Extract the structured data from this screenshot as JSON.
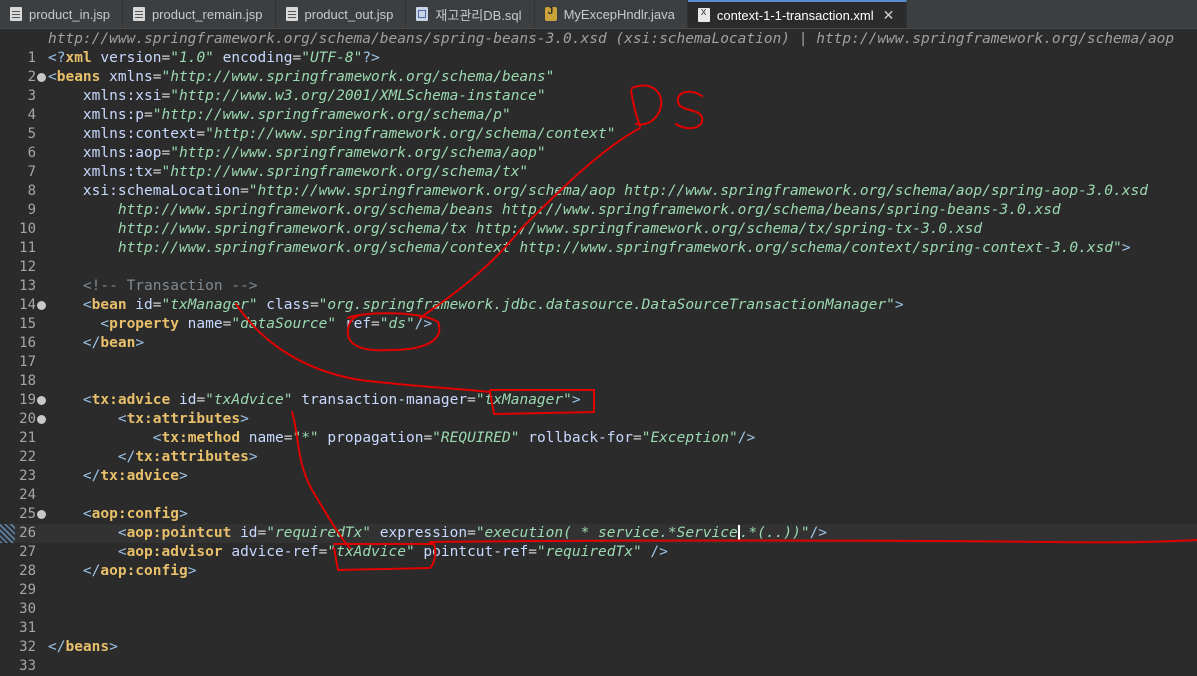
{
  "tabs": [
    {
      "label": "product_in.jsp",
      "icon": "jsp-file-icon"
    },
    {
      "label": "product_remain.jsp",
      "icon": "jsp-file-icon"
    },
    {
      "label": "product_out.jsp",
      "icon": "jsp-file-icon"
    },
    {
      "label": "재고관리DB.sql",
      "icon": "sql-file-icon"
    },
    {
      "label": "MyExcepHndlr.java",
      "icon": "java-file-icon"
    },
    {
      "label": "context-1-1-transaction.xml",
      "icon": "xml-file-icon",
      "active": true
    }
  ],
  "breadcrumb": "http://www.springframework.org/schema/beans/spring-beans-3.0.xsd (xsi:schemaLocation) | http://www.springframework.org/schema/aop",
  "lines": [
    {
      "n": "1",
      "tokens": [
        [
          "p",
          "<?"
        ],
        [
          "t",
          "xml"
        ],
        [
          "a",
          " version"
        ],
        [
          "pl",
          "="
        ],
        [
          "s",
          "\"1.0\""
        ],
        [
          "a",
          " encoding"
        ],
        [
          "pl",
          "="
        ],
        [
          "s",
          "\"UTF-8\""
        ],
        [
          "p",
          "?>"
        ]
      ]
    },
    {
      "n": "2",
      "fold": true,
      "tokens": [
        [
          "p",
          "<"
        ],
        [
          "t",
          "beans"
        ],
        [
          "a",
          " xmlns"
        ],
        [
          "pl",
          "="
        ],
        [
          "s",
          "\"http://www.springframework.org/schema/beans\""
        ]
      ]
    },
    {
      "n": "3",
      "tokens": [
        [
          "a",
          "    xmlns:xsi"
        ],
        [
          "pl",
          "="
        ],
        [
          "s",
          "\"http://www.w3.org/2001/XMLSchema-instance\""
        ]
      ]
    },
    {
      "n": "4",
      "tokens": [
        [
          "a",
          "    xmlns:p"
        ],
        [
          "pl",
          "="
        ],
        [
          "s",
          "\"http://www.springframework.org/schema/p\""
        ]
      ]
    },
    {
      "n": "5",
      "tokens": [
        [
          "a",
          "    xmlns:context"
        ],
        [
          "pl",
          "="
        ],
        [
          "s",
          "\"http://www.springframework.org/schema/context\""
        ]
      ]
    },
    {
      "n": "6",
      "tokens": [
        [
          "a",
          "    xmlns:aop"
        ],
        [
          "pl",
          "="
        ],
        [
          "s",
          "\"http://www.springframework.org/schema/aop\""
        ]
      ]
    },
    {
      "n": "7",
      "tokens": [
        [
          "a",
          "    xmlns:tx"
        ],
        [
          "pl",
          "="
        ],
        [
          "s",
          "\"http://www.springframework.org/schema/tx\""
        ]
      ]
    },
    {
      "n": "8",
      "tokens": [
        [
          "a",
          "    xsi:schemaLocation"
        ],
        [
          "pl",
          "="
        ],
        [
          "s",
          "\"http://www.springframework.org/schema/aop http://www.springframework.org/schema/aop/spring-aop-3.0.xsd"
        ]
      ]
    },
    {
      "n": "9",
      "tokens": [
        [
          "s",
          "        http://www.springframework.org/schema/beans http://www.springframework.org/schema/beans/spring-beans-3.0.xsd"
        ]
      ]
    },
    {
      "n": "10",
      "tokens": [
        [
          "s",
          "        http://www.springframework.org/schema/tx http://www.springframework.org/schema/tx/spring-tx-3.0.xsd"
        ]
      ]
    },
    {
      "n": "11",
      "tokens": [
        [
          "s",
          "        http://www.springframework.org/schema/context http://www.springframework.org/schema/context/spring-context-3.0.xsd\""
        ],
        [
          "p",
          ">"
        ]
      ]
    },
    {
      "n": "12",
      "tokens": []
    },
    {
      "n": "13",
      "tokens": [
        [
          "c",
          "    <!-- Transaction -->"
        ]
      ]
    },
    {
      "n": "14",
      "fold": true,
      "tokens": [
        [
          "p",
          "    <"
        ],
        [
          "t",
          "bean"
        ],
        [
          "a",
          " id"
        ],
        [
          "pl",
          "="
        ],
        [
          "s",
          "\"txManager\""
        ],
        [
          "a",
          " class"
        ],
        [
          "pl",
          "="
        ],
        [
          "s",
          "\"org.springframework.jdbc.datasource.DataSourceTransactionManager\""
        ],
        [
          "p",
          ">"
        ]
      ]
    },
    {
      "n": "15",
      "tokens": [
        [
          "p",
          "      <"
        ],
        [
          "t",
          "property"
        ],
        [
          "a",
          " name"
        ],
        [
          "pl",
          "="
        ],
        [
          "s",
          "\"dataSource\""
        ],
        [
          "a",
          " ref"
        ],
        [
          "pl",
          "="
        ],
        [
          "s",
          "\"ds\""
        ],
        [
          "p",
          "/>"
        ]
      ]
    },
    {
      "n": "16",
      "tokens": [
        [
          "p",
          "    </"
        ],
        [
          "t",
          "bean"
        ],
        [
          "p",
          ">"
        ]
      ]
    },
    {
      "n": "17",
      "tokens": []
    },
    {
      "n": "18",
      "tokens": []
    },
    {
      "n": "19",
      "fold": true,
      "tokens": [
        [
          "p",
          "    <"
        ],
        [
          "t",
          "tx:advice"
        ],
        [
          "a",
          " id"
        ],
        [
          "pl",
          "="
        ],
        [
          "s",
          "\"txAdvice\""
        ],
        [
          "a",
          " transaction-manager"
        ],
        [
          "pl",
          "="
        ],
        [
          "s",
          "\"txManager\""
        ],
        [
          "p",
          ">"
        ]
      ]
    },
    {
      "n": "20",
      "fold": true,
      "tokens": [
        [
          "p",
          "        <"
        ],
        [
          "t",
          "tx:attributes"
        ],
        [
          "p",
          ">"
        ]
      ]
    },
    {
      "n": "21",
      "tokens": [
        [
          "p",
          "            <"
        ],
        [
          "t",
          "tx:method"
        ],
        [
          "a",
          " name"
        ],
        [
          "pl",
          "="
        ],
        [
          "s",
          "\"*\""
        ],
        [
          "a",
          " propagation"
        ],
        [
          "pl",
          "="
        ],
        [
          "s",
          "\"REQUIRED\""
        ],
        [
          "a",
          " rollback-for"
        ],
        [
          "pl",
          "="
        ],
        [
          "s",
          "\"Exception\""
        ],
        [
          "p",
          "/>"
        ]
      ]
    },
    {
      "n": "22",
      "tokens": [
        [
          "p",
          "        </"
        ],
        [
          "t",
          "tx:attributes"
        ],
        [
          "p",
          ">"
        ]
      ]
    },
    {
      "n": "23",
      "tokens": [
        [
          "p",
          "    </"
        ],
        [
          "t",
          "tx:advice"
        ],
        [
          "p",
          ">"
        ]
      ]
    },
    {
      "n": "24",
      "tokens": []
    },
    {
      "n": "25",
      "fold": true,
      "tokens": [
        [
          "p",
          "    <"
        ],
        [
          "t",
          "aop:config"
        ],
        [
          "p",
          ">"
        ]
      ]
    },
    {
      "n": "26",
      "current": true,
      "tokens": [
        [
          "p",
          "        <"
        ],
        [
          "t",
          "aop:pointcut"
        ],
        [
          "a",
          " id"
        ],
        [
          "pl",
          "="
        ],
        [
          "s",
          "\"requiredTx\""
        ],
        [
          "a",
          " expression"
        ],
        [
          "pl",
          "="
        ],
        [
          "s",
          "\"execution( * service.*Service"
        ],
        [
          "cursor",
          ""
        ],
        [
          "s",
          ".*(..))\""
        ],
        [
          "p",
          "/>"
        ]
      ]
    },
    {
      "n": "27",
      "tokens": [
        [
          "p",
          "        <"
        ],
        [
          "t",
          "aop:advisor"
        ],
        [
          "a",
          " advice-ref"
        ],
        [
          "pl",
          "="
        ],
        [
          "s",
          "\"txAdvice\""
        ],
        [
          "a",
          " pointcut-ref"
        ],
        [
          "pl",
          "="
        ],
        [
          "s",
          "\"requiredTx\""
        ],
        [
          "p",
          " />"
        ]
      ]
    },
    {
      "n": "28",
      "tokens": [
        [
          "p",
          "    </"
        ],
        [
          "t",
          "aop:config"
        ],
        [
          "p",
          ">"
        ]
      ]
    },
    {
      "n": "29",
      "tokens": []
    },
    {
      "n": "30",
      "tokens": []
    },
    {
      "n": "31",
      "tokens": []
    },
    {
      "n": "32",
      "tokens": [
        [
          "p",
          "</"
        ],
        [
          "t",
          "beans"
        ],
        [
          "p",
          ">"
        ]
      ]
    },
    {
      "n": "33",
      "tokens": []
    }
  ],
  "annotation": {
    "text": "DS",
    "color": "#e00000"
  },
  "colors": {
    "background": "#2b2b2b",
    "ink": "#e00000",
    "tag": "#e8bf6a",
    "string": "#9bd9b0"
  }
}
